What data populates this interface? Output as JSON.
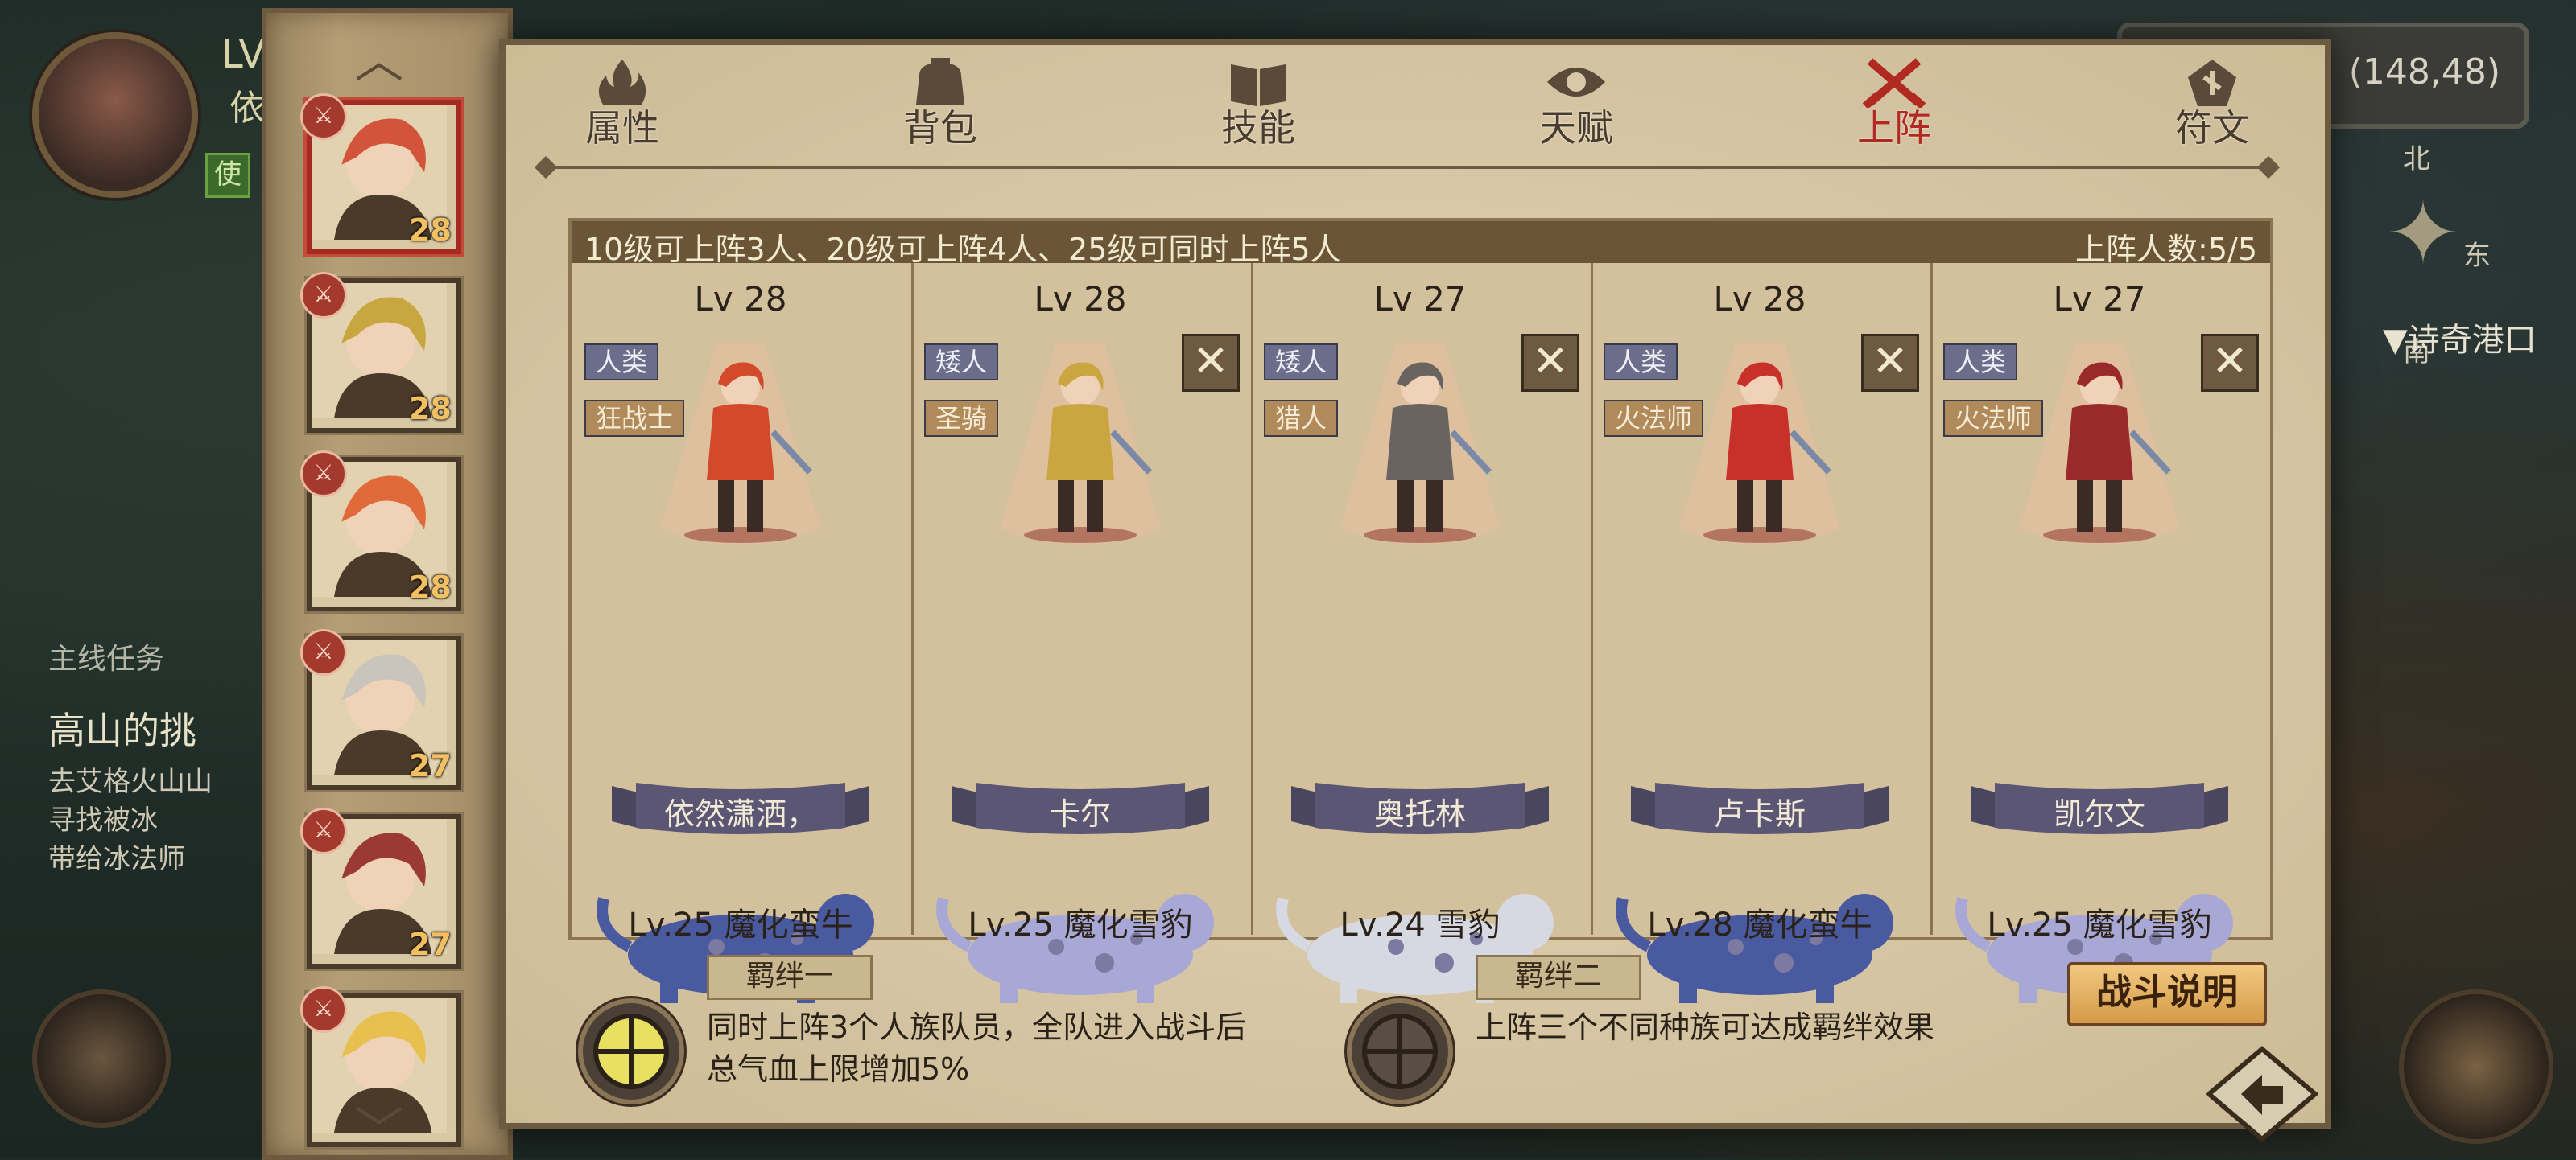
{
  "hud": {
    "level_label": "LV",
    "player_name_partial": "依",
    "quest_header": "主线任务",
    "quest_title": "高山的挑",
    "quest_lines": [
      "去艾格火山山",
      "寻找被冰",
      "带给冰法师"
    ],
    "green_badge": "使"
  },
  "coords": "(148,48)",
  "compass": {
    "north": "北",
    "east": "东",
    "south": "南"
  },
  "map_label": "▼诗奇港口",
  "sidebar": {
    "heroes": [
      {
        "level": "28",
        "selected": true,
        "color": "#d2543a"
      },
      {
        "level": "28",
        "selected": false,
        "color": "#c8a640"
      },
      {
        "level": "28",
        "selected": false,
        "color": "#e06a3a"
      },
      {
        "level": "27",
        "selected": false,
        "color": "#c9c4bc"
      },
      {
        "level": "27",
        "selected": false,
        "color": "#9a3a32"
      },
      {
        "level": "",
        "selected": false,
        "color": "#e8c050"
      }
    ]
  },
  "tabs": [
    {
      "label": "属性",
      "icon": "flame-icon"
    },
    {
      "label": "背包",
      "icon": "bag-icon"
    },
    {
      "label": "技能",
      "icon": "book-icon"
    },
    {
      "label": "天赋",
      "icon": "eye-icon"
    },
    {
      "label": "上阵",
      "icon": "crossed-swords-icon",
      "active": true
    },
    {
      "label": "符文",
      "icon": "rune-icon"
    }
  ],
  "lineup": {
    "rule_text": "10级可上阵3人、20级可上阵4人、25级可同时上阵5人",
    "count_text": "上阵人数:5/5",
    "members": [
      {
        "level": "Lv 28",
        "race": "人类",
        "class": "狂战士",
        "name": "依然潇洒，",
        "removable": false,
        "pet": "Lv.25 魔化蛮牛",
        "hero_color": "#d24a2a",
        "pet_color": "#4a5aa0"
      },
      {
        "level": "Lv 28",
        "race": "矮人",
        "class": "圣骑",
        "name": "卡尔",
        "removable": true,
        "pet": "Lv.25 魔化雪豹",
        "hero_color": "#c9a640",
        "pet_color": "#a8a8d6"
      },
      {
        "level": "Lv 27",
        "race": "矮人",
        "class": "猎人",
        "name": "奥托林",
        "removable": true,
        "pet": "Lv.24 雪豹",
        "hero_color": "#6a6460",
        "pet_color": "#d6d8e2"
      },
      {
        "level": "Lv 28",
        "race": "人类",
        "class": "火法师",
        "name": "卢卡斯",
        "removable": true,
        "pet": "Lv.28 魔化蛮牛",
        "hero_color": "#c8302a",
        "pet_color": "#4a5aa0"
      },
      {
        "level": "Lv 27",
        "race": "人类",
        "class": "火法师",
        "name": "凯尔文",
        "removable": true,
        "pet": "Lv.25 魔化雪豹",
        "hero_color": "#9a2a2a",
        "pet_color": "#a8a8d6"
      }
    ]
  },
  "bonds": [
    {
      "title": "羁绊一",
      "desc_lines": [
        "同时上阵3个人族队员，全队进入战斗后",
        "总气血上限增加5%"
      ],
      "active": true
    },
    {
      "title": "羁绊二",
      "desc_lines": [
        "上阵三个不同种族可达成羁绊效果"
      ],
      "active": false
    }
  ],
  "battle_button": "战斗说明",
  "close_symbol": "✕"
}
